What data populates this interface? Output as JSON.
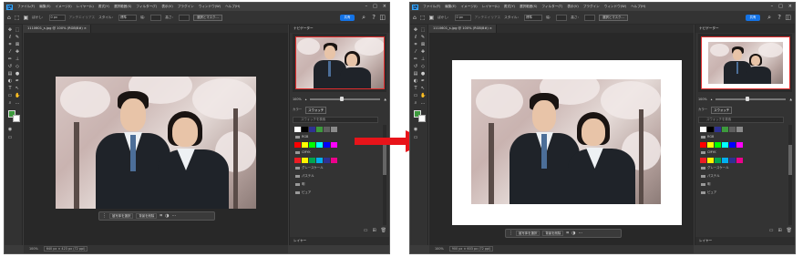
{
  "left_window": {
    "app_badge": "Ps",
    "menu": [
      "ファイル(F)",
      "編集(E)",
      "イメージ(I)",
      "レイヤー(L)",
      "書式(Y)",
      "選択範囲(S)",
      "フィルター(T)",
      "表示(V)",
      "プラグイン",
      "ウィンドウ(W)",
      "ヘルプ(H)"
    ],
    "options": {
      "feather_label": "ぼかし：",
      "feather_value": "0 px",
      "antialias_label": "アンチエイリアス",
      "style_label": "スタイル：",
      "style_value": "標準",
      "width_label": "幅：",
      "height_label": "高さ：",
      "select_mask_button": "選択とマスク...",
      "share_button": "共有"
    },
    "tab_title": "1110601_s.jpg @ 100% (RGB/8#) ×",
    "context_bar": {
      "select_subject": "被写体を選択",
      "remove_bg": "背景を削除"
    },
    "panel": {
      "title": "ナビゲーター",
      "zoom": "100%",
      "subtabs": [
        "カラー",
        "スウォッチ"
      ],
      "search_placeholder": "スウォッチを検索",
      "groups": [
        "RGB",
        "CMYK",
        "グレースケール",
        "パステル",
        "明",
        "ピュア"
      ],
      "layers_title": "レイヤー"
    },
    "status": {
      "zoom": "100%",
      "doc": "640 px × 423 px (72 ppi)"
    }
  },
  "right_window": {
    "app_badge": "Ps",
    "menu": [
      "ファイル(F)",
      "編集(E)",
      "イメージ(I)",
      "レイヤー(L)",
      "書式(Y)",
      "選択範囲(S)",
      "フィルター(T)",
      "表示(V)",
      "プラグイン",
      "ウィンドウ(W)",
      "ヘルプ(H)"
    ],
    "options": {
      "feather_label": "ぼかし：",
      "feather_value": "0 px",
      "antialias_label": "アンチエイリアス",
      "style_label": "スタイル：",
      "style_value": "標準",
      "width_label": "幅：",
      "height_label": "高さ：",
      "select_mask_button": "選択とマスク...",
      "share_button": "共有"
    },
    "tab_title": "1110601_s.jpg @ 100% (RGB/8#) ×",
    "context_bar": {
      "select_subject": "被写体を選択",
      "remove_bg": "背景を削除"
    },
    "panel": {
      "title": "ナビゲーター",
      "zoom": "100%",
      "subtabs": [
        "カラー",
        "スウォッチ"
      ],
      "search_placeholder": "スウォッチを検索",
      "groups": [
        "RGB",
        "CMYK",
        "グレースケール",
        "パステル",
        "明",
        "ピュア"
      ],
      "layers_title": "レイヤー"
    },
    "status": {
      "zoom": "100%",
      "doc": "900 px × 603 px (72 ppi)"
    }
  },
  "swatch_colors": {
    "rgb": [
      "#ff0000",
      "#ffff00",
      "#00ff00",
      "#00ffff",
      "#0000ff",
      "#ff00ff"
    ],
    "cmyk": [
      "#ed1c24",
      "#fff200",
      "#00a651",
      "#00aeef",
      "#2e3192",
      "#ec008c"
    ]
  },
  "arrow_color": "#e8141a"
}
